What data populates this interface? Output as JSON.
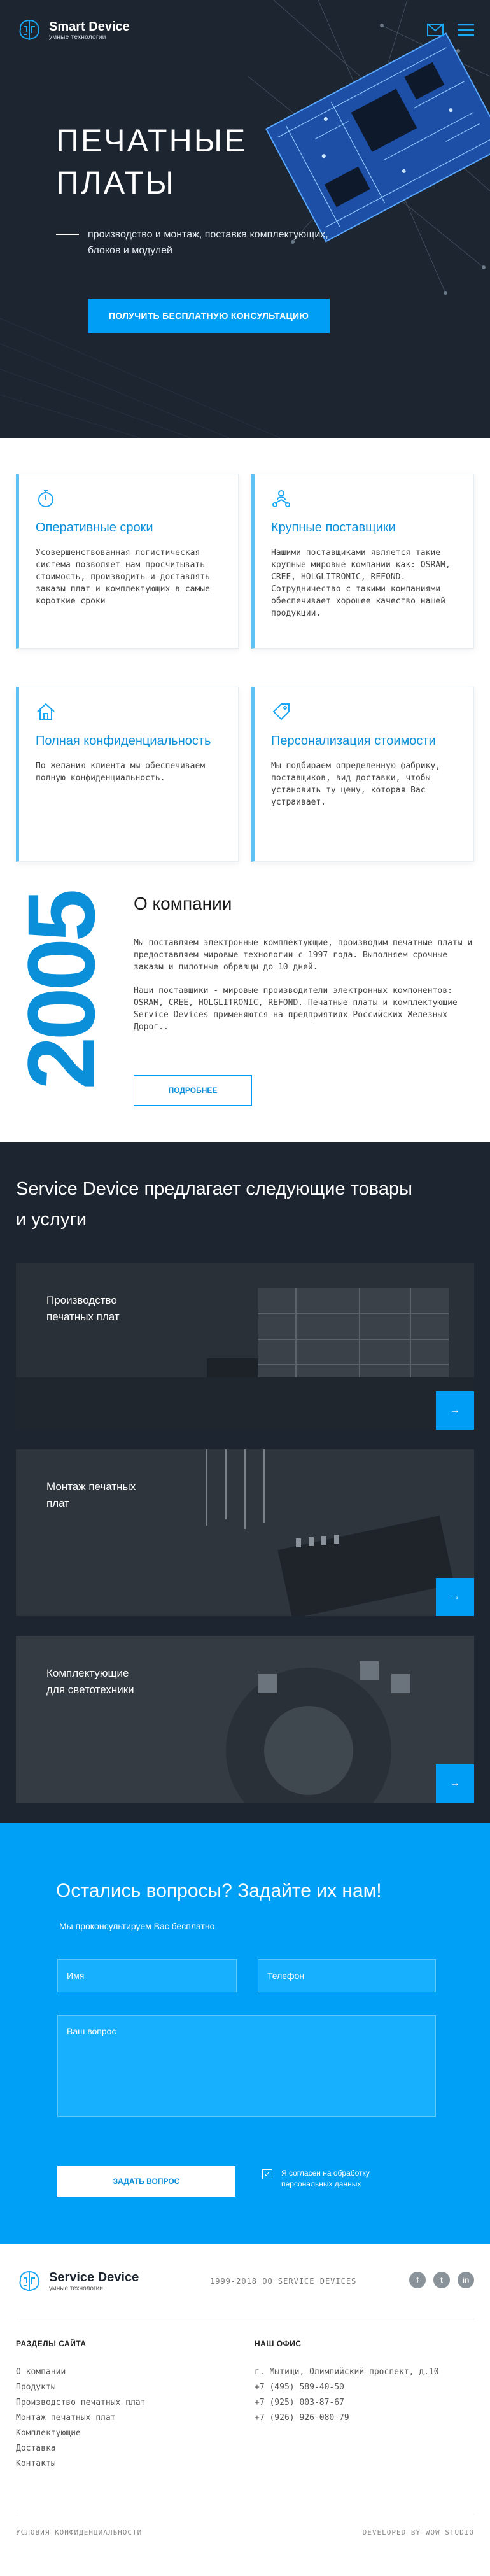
{
  "header": {
    "brand": "Smart Device",
    "tagline": "умные технологии",
    "icons": [
      "mail-icon",
      "menu-icon"
    ]
  },
  "hero": {
    "title_line1": "ПЕЧАТНЫЕ",
    "title_line2": "ПЛАТЫ",
    "subtitle": "производство и монтаж, поставка комплектующих, блоков и модулей",
    "cta": "ПОЛУЧИТЬ БЕСПЛАТНУЮ КОНСУЛЬТАЦИЮ"
  },
  "features": [
    {
      "icon": "stopwatch-icon",
      "title": "Оперативные сроки",
      "text": "Усовершенствованная логистическая система позволяет нам просчитывать стоимость, производить и доставлять заказы плат и комплектующих в самые короткие сроки"
    },
    {
      "icon": "supplier-network-icon",
      "title": "Крупные поставщики",
      "text": "Нашими поставщиками является такие крупные мировые компании как: OSRAM, CREE, HOLGLITRONIC, REFOND. Сотрудничество с такими компаниями обеспечивает хорошее качество нашей продукции."
    },
    {
      "icon": "home-icon",
      "title": "Полная конфиденциальность",
      "text": "По желанию клиента мы обеспечиваем полную конфиденциальность."
    },
    {
      "icon": "price-tag-icon",
      "title": "Персонализация стоимости",
      "text": "Мы подбираем определенную фабрику, поставщиков, вид доставки, чтобы установить ту цену, которая Вас устраивает."
    }
  ],
  "about": {
    "year": "2005",
    "title": "О компании",
    "p1": "Мы поставляем электронные комплектующие, производим печатные платы и предоставляем мировые технологии с 1997 года. Выполняем срочные заказы и пилотные образцы до 10 дней.",
    "p2": "Наши поставщики - мировые производители электронных компонентов: OSRAM, CREE, HOLGLITRONIC, REFOND. Печатные платы и комплектующие Service Devices применяются на предприятиях Российских Железных Дорог..",
    "more": "ПОДРОБНЕЕ"
  },
  "services": {
    "title": "Service Device предлагает следующие товары и услуги",
    "items": [
      {
        "line1": "Производство",
        "line2": "печатных плат"
      },
      {
        "line1": "Монтаж печатных",
        "line2": "плат"
      },
      {
        "line1": "Комплектующие",
        "line2": "для светотехники"
      }
    ],
    "arrow": "→"
  },
  "contact": {
    "title": "Остались вопросы? Задайте их нам!",
    "lead": "Мы проконсультируем Вас бесплатно",
    "name_placeholder": "Имя",
    "phone_placeholder": "Телефон",
    "question_placeholder": "Ваш вопрос",
    "submit": "ЗАДАТЬ ВОПРОС",
    "agree": "Я согласен на обработку персональных данных",
    "check": "✓"
  },
  "footer": {
    "brand": "Service Device",
    "tagline": "умные технологии",
    "copyright": "1999-2018 ОО SERVICE DEVICES",
    "socials": [
      "f",
      "t",
      "in"
    ],
    "sections_title": "РАЗДЕЛЫ САЙТА",
    "sections": [
      "О компании",
      "Продукты",
      "Производство печатных плат",
      "Монтаж печатных плат",
      "Комплектующие",
      "Доставка",
      "Контакты"
    ],
    "office_title": "НАШ ОФИС",
    "office": [
      "г. Мытищи, Олимпийский проспект, д.10",
      "+7 (495) 589-40-50",
      "+7 (925) 003-87-67",
      "+7 (926) 926-080-79"
    ],
    "terms": "УСЛОВИЯ КОНФИДЕНЦИАЛЬНОСТИ",
    "developer": "DEVELOPED BY WOW STUDIO"
  },
  "colors": {
    "accent": "#009ff5",
    "dark": "#1c2530",
    "contact_bg": "#00a0f7"
  }
}
